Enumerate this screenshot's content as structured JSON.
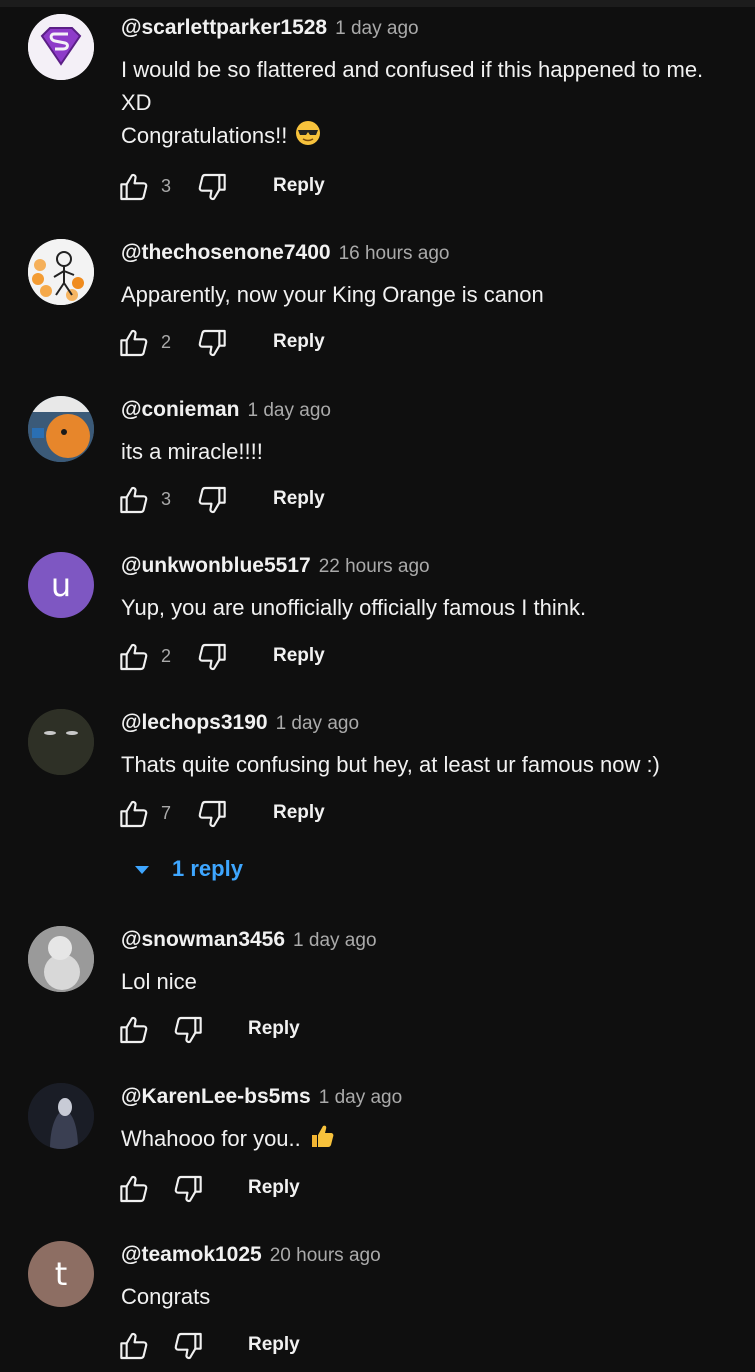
{
  "comments": [
    {
      "username": "@scarlettparker1528",
      "time": "1 day ago",
      "lines": [
        "I would be so flattered and confused if this happened to me.",
        "XD",
        "Congratulations!!"
      ],
      "emoji": "sunglasses-emoji",
      "likes": "3",
      "reply_label": "Reply",
      "avatar": {
        "kind": "superman-logo",
        "bg": "#f4f0f7"
      }
    },
    {
      "username": "@thechosenone7400",
      "time": "16 hours ago",
      "lines": [
        "Apparently, now your King Orange is canon"
      ],
      "likes": "2",
      "reply_label": "Reply",
      "avatar": {
        "kind": "stick-figure",
        "bg": "#f3f3f3"
      }
    },
    {
      "username": "@conieman",
      "time": "1 day ago",
      "lines": [
        "its a miracle!!!!"
      ],
      "likes": "3",
      "reply_label": "Reply",
      "avatar": {
        "kind": "orange-character",
        "bg": "#3b5a78"
      }
    },
    {
      "username": "@unkwonblue5517",
      "time": "22 hours ago",
      "lines": [
        "Yup, you are unofficially officially famous I think."
      ],
      "likes": "2",
      "reply_label": "Reply",
      "avatar": {
        "kind": "letter",
        "letter": "u",
        "bg": "#7e57c2"
      }
    },
    {
      "username": "@lechops3190",
      "time": "1 day ago",
      "lines": [
        "Thats quite confusing but hey, at least ur famous now :)"
      ],
      "likes": "7",
      "reply_label": "Reply",
      "replies_label": "1 reply",
      "avatar": {
        "kind": "dark-face",
        "bg": "#2e3026"
      }
    },
    {
      "username": "@snowman3456",
      "time": "1 day ago",
      "lines": [
        "Lol nice"
      ],
      "likes": "",
      "reply_label": "Reply",
      "avatar": {
        "kind": "snowman",
        "bg": "#9a9a9a"
      }
    },
    {
      "username": "@KarenLee-bs5ms",
      "time": "1 day ago",
      "lines": [
        "Whahooo for you.."
      ],
      "emoji": "thumbs-up-emoji",
      "likes": "",
      "reply_label": "Reply",
      "avatar": {
        "kind": "dark-figure",
        "bg": "#1a1d26"
      }
    },
    {
      "username": "@teamok1025",
      "time": "20 hours ago",
      "lines": [
        "Congrats"
      ],
      "likes": "",
      "reply_label": "Reply",
      "avatar": {
        "kind": "letter",
        "letter": "t",
        "bg": "#8d6e63"
      }
    }
  ],
  "colors": {
    "background": "#0f0f0f",
    "text": "#f1f1f1",
    "muted": "#aaaaaa",
    "link": "#3ea6ff"
  }
}
